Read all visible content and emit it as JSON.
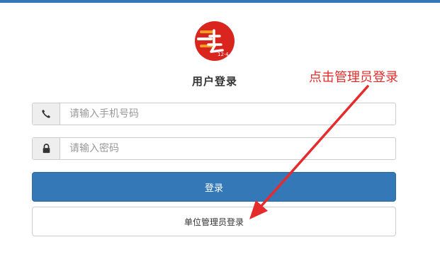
{
  "page": {
    "title": "用户登录"
  },
  "logo": {
    "icon": "court-logo-icon",
    "text": "12·4",
    "colors": {
      "primary": "#d9251d",
      "accent": "#f2a020"
    }
  },
  "form": {
    "phone": {
      "placeholder": "请输入手机号码",
      "value": "",
      "icon": "phone-icon"
    },
    "password": {
      "placeholder": "请输入密码",
      "value": "",
      "icon": "lock-icon"
    },
    "login_label": "登录",
    "admin_login_label": "单位管理员登录"
  },
  "annotation": {
    "text": "点击管理员登录",
    "color": "#e52b2b"
  },
  "theme": {
    "top_bar": "#3576b7",
    "primary_button": "#3578b8"
  }
}
